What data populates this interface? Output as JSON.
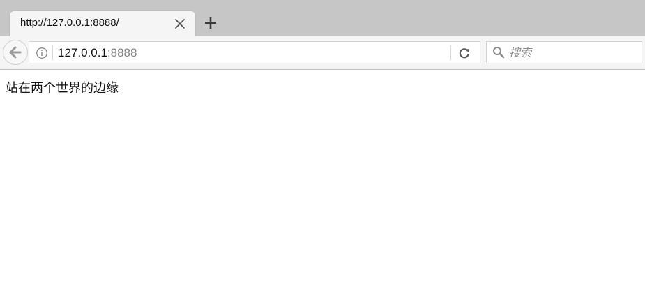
{
  "tab": {
    "title": "http://127.0.0.1:8888/",
    "close_icon": "close-icon"
  },
  "tabstrip": {
    "new_tab_icon": "plus-icon"
  },
  "toolbar": {
    "back_icon": "arrow-left-icon",
    "info_icon": "info-icon",
    "reload_icon": "reload-icon",
    "url": {
      "host": "127.0.0.1",
      "port": ":8888"
    },
    "search": {
      "placeholder": "搜索",
      "icon": "search-icon"
    }
  },
  "page": {
    "text": "站在两个世界的边缘"
  },
  "colors": {
    "tabstrip_bg": "#c6c6c6",
    "toolbar_bg": "#f5f5f5",
    "tab_bg": "#f5f5f5",
    "url_port": "#808080"
  }
}
